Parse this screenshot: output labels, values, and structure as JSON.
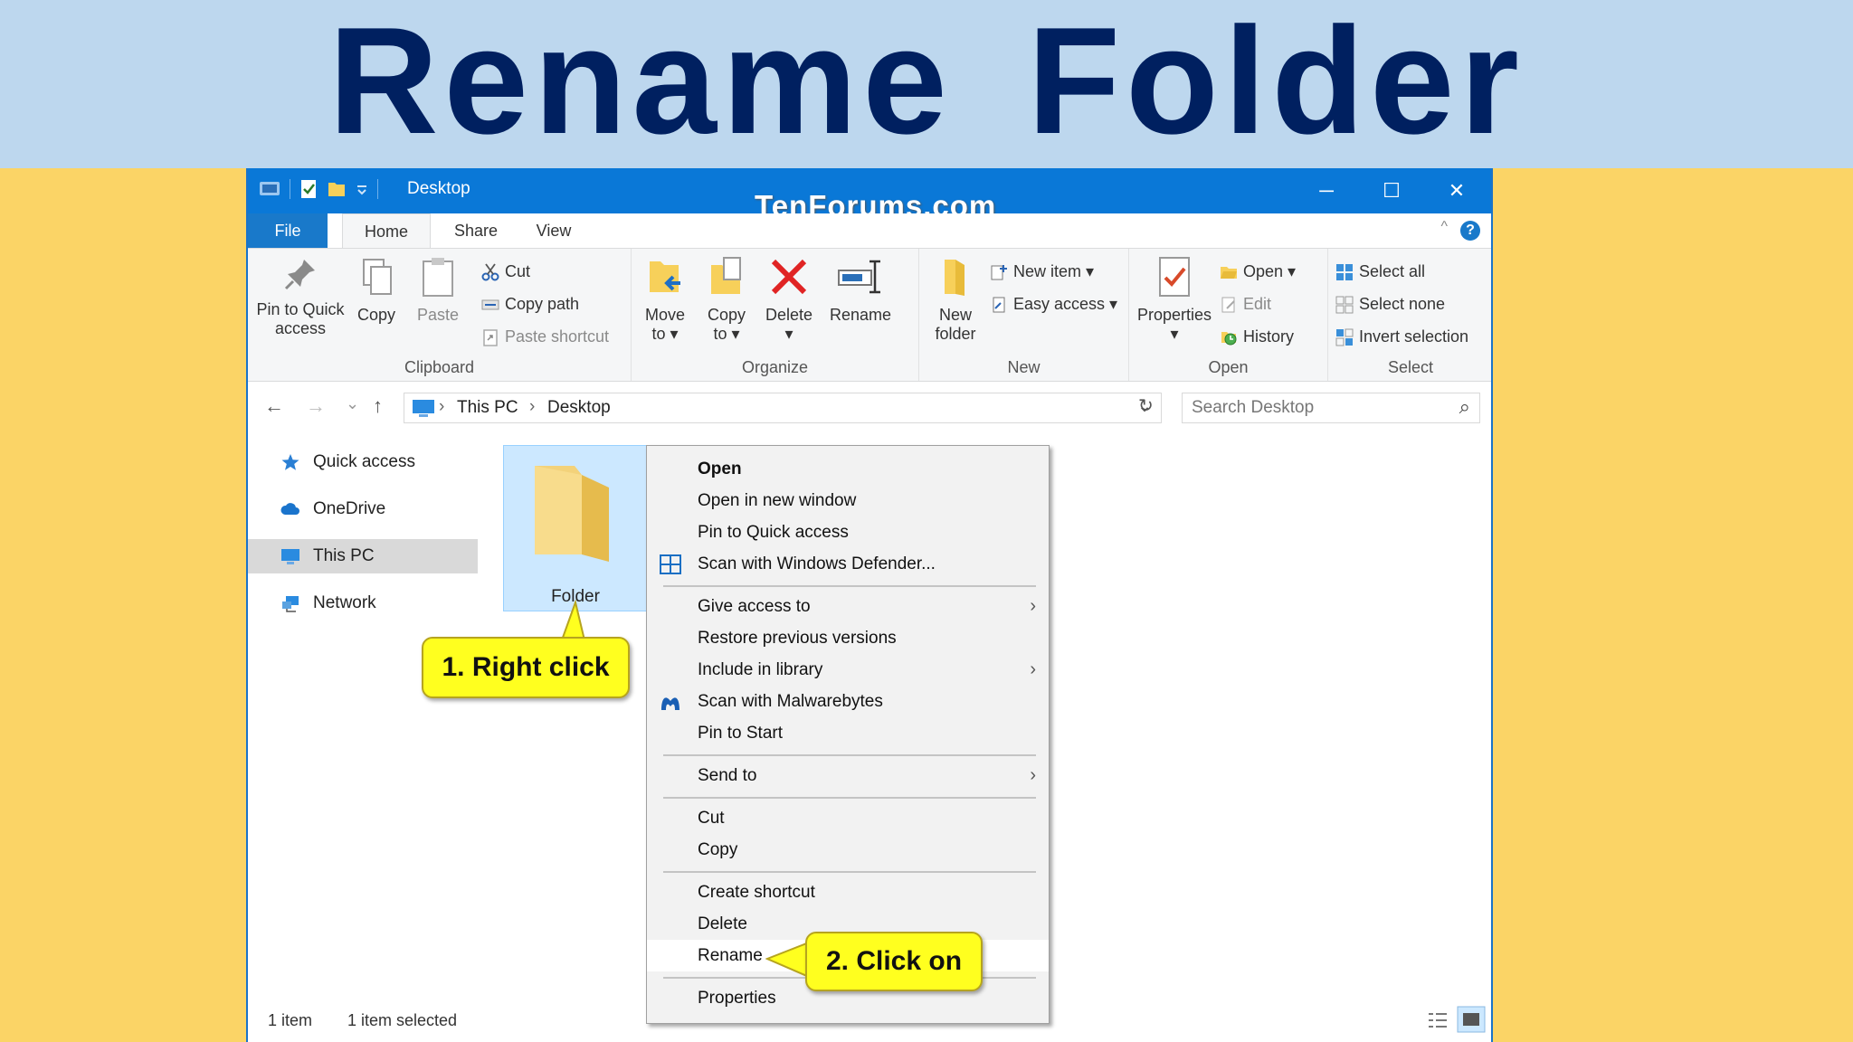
{
  "banner": {
    "title": "Rename Folder"
  },
  "window": {
    "title": "Desktop",
    "watermark": "TenForums.com",
    "controls": {
      "minimize": "─",
      "maximize": "☐",
      "close": "✕"
    }
  },
  "tabs": {
    "file": "File",
    "home": "Home",
    "share": "Share",
    "view": "View",
    "help": "?",
    "collapse": "^"
  },
  "ribbon": {
    "clipboard": {
      "label": "Clipboard",
      "pin_line1": "Pin to Quick",
      "pin_line2": "access",
      "copy": "Copy",
      "paste": "Paste",
      "cut": "Cut",
      "copy_path": "Copy path",
      "paste_shortcut": "Paste shortcut"
    },
    "organize": {
      "label": "Organize",
      "move_line1": "Move",
      "move_line2": "to ▾",
      "copy_line1": "Copy",
      "copy_line2": "to ▾",
      "delete": "Delete",
      "delete_arrow": "▾",
      "rename": "Rename"
    },
    "new": {
      "label": "New",
      "new_folder_line1": "New",
      "new_folder_line2": "folder",
      "new_item": "New item ▾",
      "easy_access": "Easy access ▾"
    },
    "open": {
      "label": "Open",
      "properties": "Properties",
      "properties_arrow": "▾",
      "open": "Open ▾",
      "edit": "Edit",
      "history": "History"
    },
    "select": {
      "label": "Select",
      "select_all": "Select all",
      "select_none": "Select none",
      "invert_selection": "Invert selection"
    }
  },
  "address": {
    "back": "←",
    "forward": "→",
    "recent": "⌄",
    "up": "↑",
    "sep1": "›",
    "crumb1": "This PC",
    "sep2": "›",
    "crumb2": "Desktop",
    "dropdown": "⌄",
    "refresh": "↻",
    "search_placeholder": "Search Desktop",
    "search_icon": "⌕"
  },
  "nav": {
    "quick_access": "Quick access",
    "onedrive": "OneDrive",
    "this_pc": "This PC",
    "network": "Network"
  },
  "content": {
    "folder_name": "Folder"
  },
  "status": {
    "items": "1 item",
    "selected": "1 item selected"
  },
  "context_menu": {
    "open": "Open",
    "open_new_window": "Open in new window",
    "pin_quick_access": "Pin to Quick access",
    "scan_defender": "Scan with Windows Defender...",
    "give_access": "Give access to",
    "restore_versions": "Restore previous versions",
    "include_library": "Include in library",
    "scan_malwarebytes": "Scan with Malwarebytes",
    "pin_start": "Pin to Start",
    "send_to": "Send to",
    "cut": "Cut",
    "copy": "Copy",
    "create_shortcut": "Create shortcut",
    "delete": "Delete",
    "rename": "Rename",
    "properties": "Properties",
    "submenu_arrow": "›"
  },
  "callouts": {
    "step1": "1. Right click",
    "step2": "2. Click on"
  },
  "colors": {
    "banner_bg": "#bdd7ee",
    "banner_text": "#002060",
    "background": "#fbd466",
    "titlebar": "#0a78d7",
    "callout": "#ffff1f",
    "selection": "#cce8ff"
  }
}
